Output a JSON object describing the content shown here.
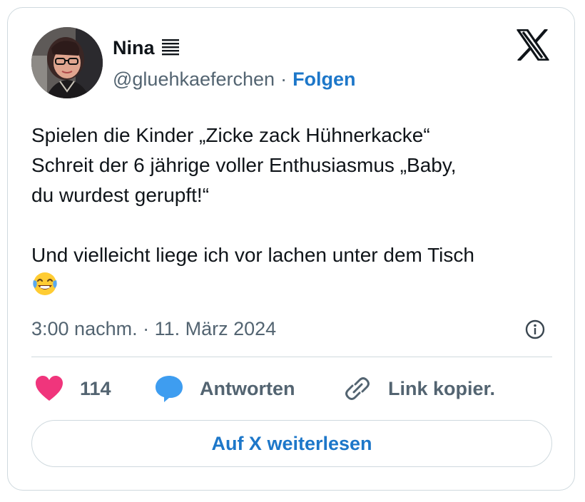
{
  "author": {
    "name": "Nina",
    "handle": "@gluehkaeferchen",
    "separator": "·",
    "follow_label": "Folgen"
  },
  "tweet": {
    "line1": "Spielen die Kinder „Zicke zack Hühnerkacke“",
    "line2": "Schreit der 6 jährige voller Enthusiasmus „Baby,",
    "line3": "du wurdest gerupft!“",
    "line4": "Und vielleicht liege ich vor lachen unter dem Tisch",
    "emoji": "face-with-tears-of-joy"
  },
  "timestamp": "3:00 nachm. · 11. März 2024",
  "actions": {
    "like_count": "114",
    "reply_label": "Antworten",
    "link_label": "Link kopier."
  },
  "read_more_label": "Auf X weiterlesen",
  "icons": {
    "like": "heart-icon",
    "reply": "speech-bubble-icon",
    "link": "link-icon",
    "info": "info-icon",
    "brand": "x-logo-icon"
  },
  "colors": {
    "accent": "#1d77c9",
    "like": "#f0357c",
    "reply": "#3e9df0",
    "muted": "#536471",
    "border": "#cfd9de"
  }
}
